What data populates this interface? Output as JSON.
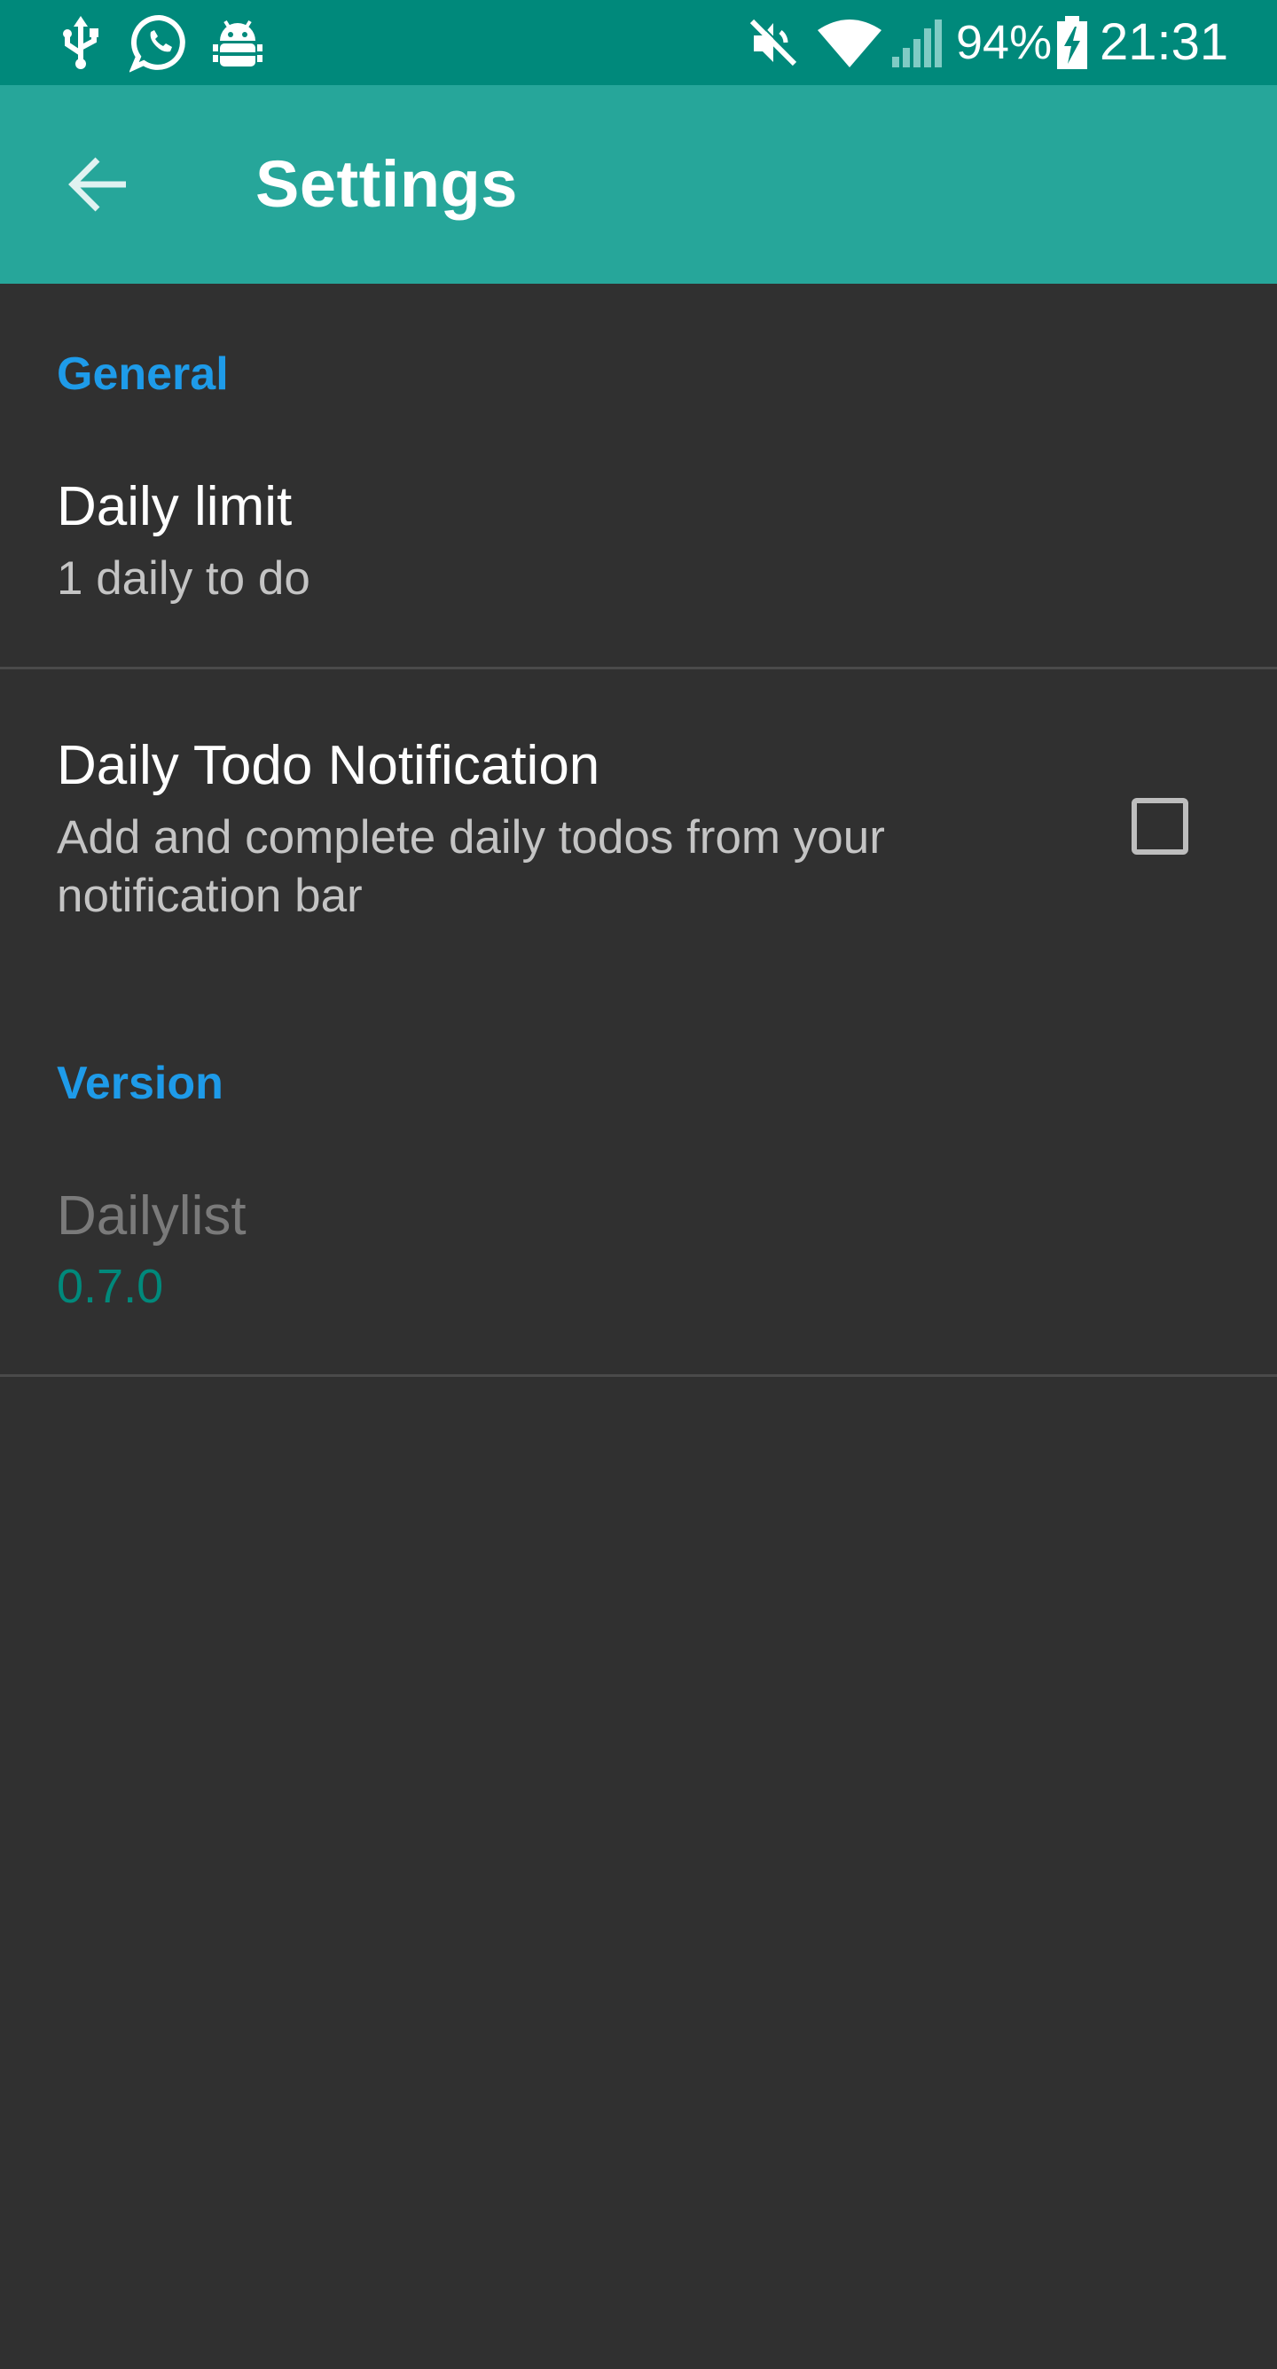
{
  "status_bar": {
    "battery_percent": "94%",
    "time": "21:31",
    "icons": [
      "usb-icon",
      "whatsapp-icon",
      "android-debug-icon",
      "mute-icon",
      "wifi-icon",
      "signal-icon",
      "battery-charging-icon"
    ]
  },
  "app_bar": {
    "title": "Settings",
    "back_icon": "arrow-back-icon"
  },
  "sections": {
    "general": {
      "header": "General",
      "daily_limit": {
        "title": "Daily limit",
        "summary": "1 daily to do"
      },
      "daily_todo_notification": {
        "title": "Daily Todo Notification",
        "summary_line1": "Add and complete daily todos from your",
        "summary_line2": "notification bar",
        "checked": false
      }
    },
    "version": {
      "header": "Version",
      "app_name": "Dailylist",
      "version_number": "0.7.0"
    }
  },
  "colors": {
    "status_bar": "#00897b",
    "app_bar": "#26a69a",
    "background": "#303030",
    "section_header": "#1e9be9",
    "version_value": "#00897b"
  }
}
